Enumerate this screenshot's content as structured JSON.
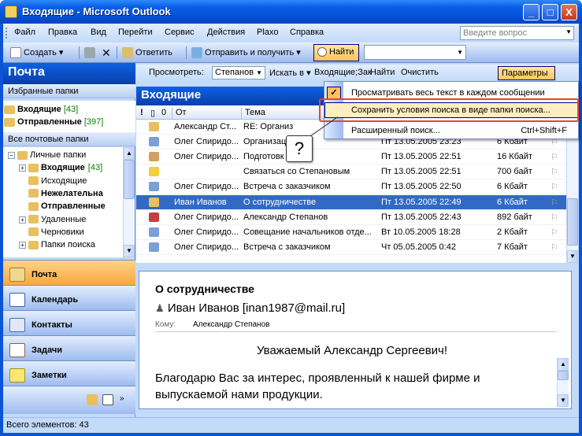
{
  "window": {
    "title": "Входящие - Microsoft Outlook",
    "min": "_",
    "max": "□",
    "close": "X"
  },
  "menu": [
    "Файл",
    "Правка",
    "Вид",
    "Перейти",
    "Сервис",
    "Действия",
    "Plaxo",
    "Справка"
  ],
  "help_placeholder": "Введите вопрос",
  "toolbar": {
    "create": "Создать",
    "reply": "Ответить",
    "send_receive": "Отправить и получить",
    "find": "Найти"
  },
  "nav": {
    "header": "Почта",
    "favorites_label": "Избранные папки",
    "favorites": [
      {
        "name": "Входящие",
        "count": "[43]"
      },
      {
        "name": "Отправленные",
        "count": "[397]"
      }
    ],
    "all_folders_label": "Все почтовые папки",
    "tree": [
      {
        "name": "Личные папки",
        "bold": false,
        "count": "",
        "indent": 0,
        "box": "−"
      },
      {
        "name": "Входящие",
        "bold": true,
        "count": "[43]",
        "indent": 1,
        "box": "+"
      },
      {
        "name": "Исходящие",
        "bold": false,
        "count": "",
        "indent": 1,
        "box": ""
      },
      {
        "name": "Нежелательна",
        "bold": true,
        "count": "",
        "indent": 1,
        "box": ""
      },
      {
        "name": "Отправленные",
        "bold": true,
        "count": "",
        "indent": 1,
        "box": ""
      },
      {
        "name": "Удаленные",
        "bold": false,
        "count": "",
        "indent": 1,
        "box": "+"
      },
      {
        "name": "Черновики",
        "bold": false,
        "count": "",
        "indent": 1,
        "box": ""
      },
      {
        "name": "Папки поиска",
        "bold": false,
        "count": "",
        "indent": 1,
        "box": "+"
      }
    ],
    "buttons": [
      "Почта",
      "Календарь",
      "Контакты",
      "Задачи",
      "Заметки"
    ]
  },
  "findbar": {
    "look_label": "Просмотреть:",
    "look_value": "Степанов",
    "search_in": "Искать в",
    "search_in_value": "Входящие;Зак",
    "find_now": "Найти",
    "clear": "Очистить",
    "options": "Параметры"
  },
  "list": {
    "header": "Входящие",
    "columns": {
      "from": "От",
      "subject": "Тема"
    },
    "rows": [
      {
        "from": "Александр Ст...",
        "subject": "RE: Организ",
        "received": "",
        "size": "",
        "selected": false,
        "color": "#e8c060"
      },
      {
        "from": "Олег Спиридо...",
        "subject": "Организаци",
        "received": "Пт 13.05.2005 23:23",
        "size": "6 Кбайт",
        "selected": false,
        "color": "#7aa0d8"
      },
      {
        "from": "Олег Спиридо...",
        "subject": "Подготовк",
        "received": "Пт 13.05.2005 22:51",
        "size": "16 Кбайт",
        "selected": false,
        "color": "#d0a060"
      },
      {
        "from": "",
        "subject": "Связаться со Степановым",
        "received": "Пт 13.05.2005 22:51",
        "size": "700 байт",
        "selected": false,
        "color": "#f0d040"
      },
      {
        "from": "Олег Спиридо...",
        "subject": "Встреча с заказчиком",
        "received": "Пт 13.05.2005 22:50",
        "size": "6 Кбайт",
        "selected": false,
        "color": "#7aa0d8"
      },
      {
        "from": "Иван Иванов",
        "subject": "О сотрудничестве",
        "received": "Пт 13.05.2005 22:49",
        "size": "6 Кбайт",
        "selected": true,
        "color": "#e8c060"
      },
      {
        "from": "Олег Спиридо...",
        "subject": "Александр Степанов",
        "received": "Пт 13.05.2005 22:43",
        "size": "892 байт",
        "selected": false,
        "color": "#c04040"
      },
      {
        "from": "Олег Спиридо...",
        "subject": "Совещание начальников отде...",
        "received": "Вт 10.05.2005 18:28",
        "size": "2 Кбайт",
        "selected": false,
        "color": "#7aa0d8"
      },
      {
        "from": "Олег Спиридо...",
        "subject": "Встреча с заказчиком",
        "received": "Чт 05.05.2005 0:42",
        "size": "7 Кбайт",
        "selected": false,
        "color": "#7aa0d8"
      }
    ]
  },
  "dropdown": {
    "items": [
      {
        "label": "Просматривать весь текст в каждом сообщении",
        "shortcut": "",
        "checked": true
      },
      {
        "label": "Сохранить условия поиска в виде папки поиска...",
        "shortcut": "",
        "checked": false
      },
      {
        "label": "Расширенный поиск...",
        "shortcut": "Ctrl+Shift+F",
        "checked": false
      }
    ]
  },
  "callout_text": "?",
  "preview": {
    "subject": "О сотрудничестве",
    "from": "Иван Иванов [inan1987@mail.ru]",
    "to_label": "Кому:",
    "to": "Александр Степанов",
    "greeting": "Уважаемый Александр Сергеевич!",
    "body": "Благодарю Вас за интерес, проявленный к нашей фирме и выпускаемой нами продукции."
  },
  "status": "Всего элементов: 43"
}
